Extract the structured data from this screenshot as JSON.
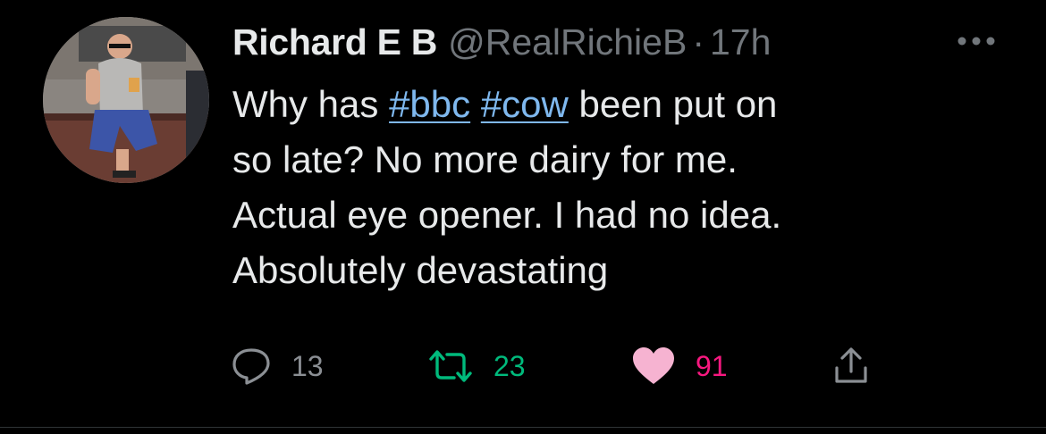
{
  "tweet": {
    "author_name": "Richard E B",
    "handle": "@RealRichieB",
    "separator": "·",
    "time": "17h",
    "more_icon": "more-horizontal-icon",
    "text_intro": "Why has ",
    "hashtags": [
      "#bbc",
      "#cow"
    ],
    "text_after_tags": " been put on",
    "lines": [
      "so late? No more dairy for me.",
      "Actual eye opener. I had no idea.",
      "Absolutely devastating"
    ],
    "actions": {
      "reply": {
        "icon": "reply-icon",
        "count": "13"
      },
      "retweet": {
        "icon": "retweet-icon",
        "count": "23"
      },
      "like": {
        "icon": "heart-icon",
        "count": "91",
        "liked": true
      },
      "share": {
        "icon": "share-icon"
      }
    }
  },
  "colors": {
    "background": "#000000",
    "text": "#e7e9ea",
    "muted": "#71767b",
    "hashtag": "#7fb8ee",
    "retweet": "#00ba7c",
    "like": "#f91880"
  }
}
